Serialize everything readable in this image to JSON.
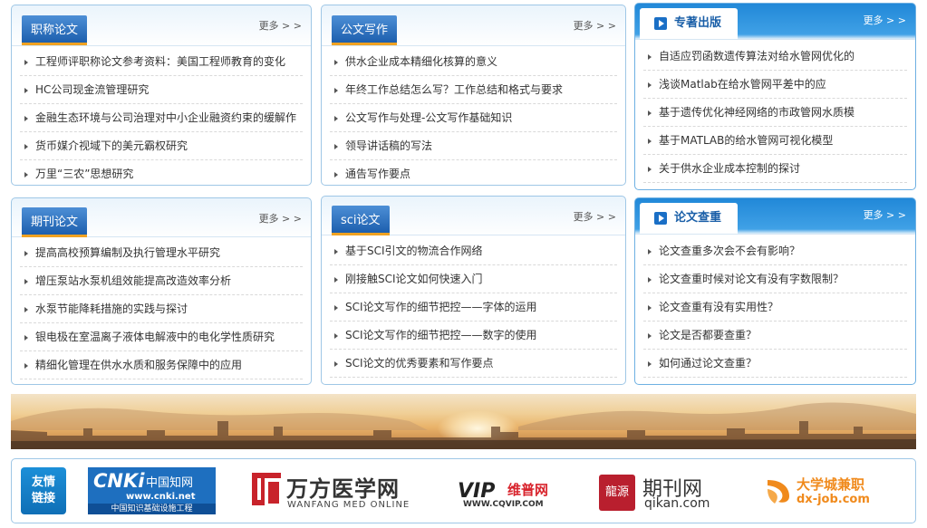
{
  "panels": [
    {
      "title": "职称论文",
      "more": "更多 > >",
      "items": [
        "工程师评职称论文参考资料：美国工程师教育的变化",
        "HC公司现金流管理研究",
        "金融生态环境与公司治理对中小企业融资约束的缓解作",
        "货币媒介视域下的美元霸权研究",
        "万里“三农”思想研究"
      ]
    },
    {
      "title": "公文写作",
      "more": "更多 > >",
      "items": [
        "供水企业成本精细化核算的意义",
        "年终工作总结怎么写？工作总结和格式与要求",
        "公文写作与处理-公文写作基础知识",
        "领导讲话稿的写法",
        "通告写作要点"
      ]
    },
    {
      "title": "专著出版",
      "more": "更多 > >",
      "items": [
        "自适应罚函数遗传算法对给水管网优化的",
        "浅谈Matlab在给水管网平差中的应",
        "基于遗传优化神经网络的市政管网水质模",
        "基于MATLAB的给水管网可视化模型",
        "关于供水企业成本控制的探讨"
      ]
    },
    {
      "title": "期刊论文",
      "more": "更多 > >",
      "items": [
        "提高高校预算编制及执行管理水平研究",
        "增压泵站水泵机组效能提高改造效率分析",
        "水泵节能降耗措施的实践与探讨",
        "银电极在室温离子液体电解液中的电化学性质研究",
        "精细化管理在供水水质和服务保障中的应用"
      ]
    },
    {
      "title": "sci论文",
      "more": "更多 > >",
      "items": [
        "基于SCI引文的物流合作网络",
        "刚接触SCI论文如何快速入门",
        "SCI论文写作的细节把控——字体的运用",
        "SCI论文写作的细节把控——数字的使用",
        "SCI论文的优秀要素和写作要点"
      ]
    },
    {
      "title": "论文查重",
      "more": "更多 > >",
      "items": [
        "论文查重多次会不会有影响？",
        "论文查重时候对论文有没有字数限制？",
        "论文查重有没有实用性？",
        "论文是否都要查重？",
        "如何通过论文查重？"
      ]
    }
  ],
  "links": {
    "label_line1": "友情",
    "label_line2": "链接",
    "cnki": {
      "mark": "CNKi",
      "cn": "中国知网",
      "url": "www.cnki.net",
      "sub": "中国知识基础设施工程"
    },
    "wanfang": {
      "name": "万方医学网",
      "sub": "WANFANG MED ONLINE"
    },
    "vip": {
      "mark": "VIP",
      "name": "维普网",
      "url": "WWW.CQVIP.COM"
    },
    "qikan": {
      "logo": "龍源",
      "name": "期刊网",
      "url": "qikan.com"
    },
    "dx": {
      "name": "大学城兼职",
      "url": "dx-job.com"
    }
  },
  "colors": {
    "tab_blue": "#1d5fae",
    "tab_underline": "#f0a221",
    "special_header": "#2188d8",
    "border": "#9fc7e6"
  }
}
